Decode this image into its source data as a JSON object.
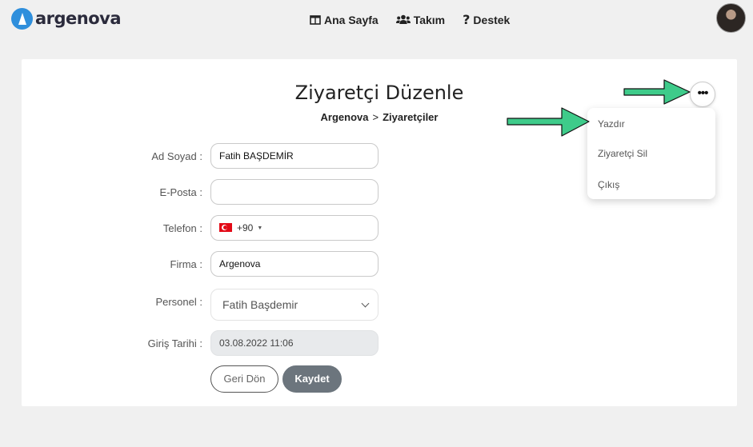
{
  "brand": {
    "name": "argenova"
  },
  "nav": {
    "items": [
      {
        "label": "Ana Sayfa",
        "icon": "columns-icon"
      },
      {
        "label": "Takım",
        "icon": "users-icon"
      },
      {
        "label": "Destek",
        "icon": "question-icon"
      }
    ]
  },
  "page": {
    "title": "Ziyaretçi Düzenle",
    "breadcrumb": [
      "Argenova",
      ">",
      "Ziyaretçiler"
    ]
  },
  "form": {
    "name": {
      "label": "Ad Soyad :",
      "value": "Fatih BAŞDEMİR"
    },
    "email": {
      "label": "E-Posta :",
      "value": ""
    },
    "phone": {
      "label": "Telefon :",
      "dial_code": "+90",
      "country_flag": "TR",
      "value": ""
    },
    "company": {
      "label": "Firma :",
      "value": "Argenova"
    },
    "personnel": {
      "label": "Personel :",
      "selected": "Fatih Başdemir"
    },
    "entry_date": {
      "label": "Giriş Tarihi :",
      "value": "03.08.2022 11:06"
    },
    "back_label": "Geri Dön",
    "save_label": "Kaydet"
  },
  "menu": {
    "items": [
      "Yazdır",
      "Ziyaretçi Sil",
      "Çıkış"
    ]
  },
  "colors": {
    "accent_arrow": "#3ecb8a",
    "save_button": "#6c757d",
    "logo_blue": "#2f8fdc"
  }
}
